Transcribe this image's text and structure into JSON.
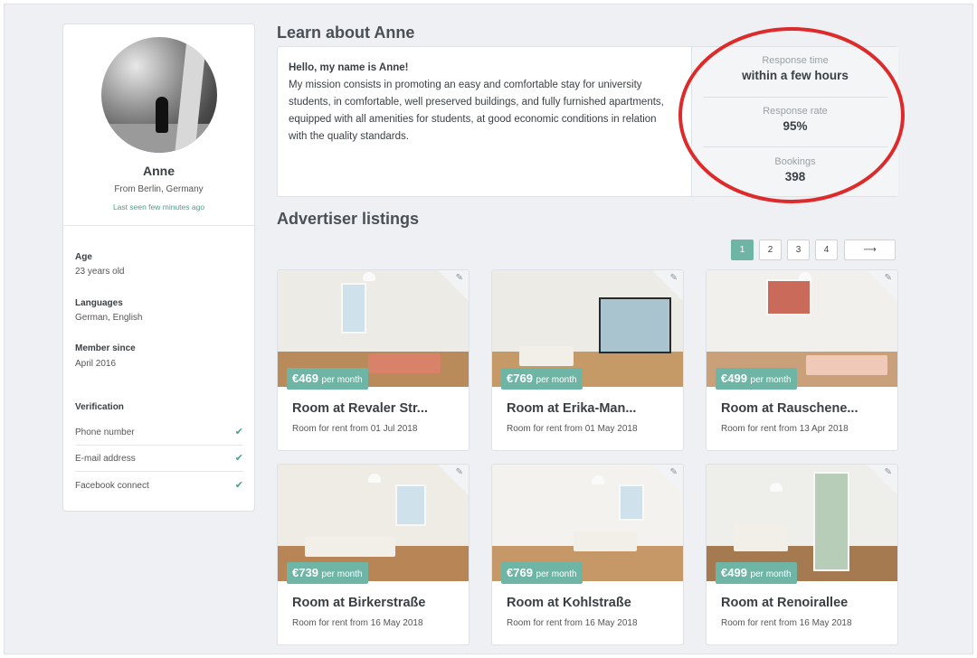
{
  "profile": {
    "name": "Anne",
    "from": "From Berlin, Germany",
    "last_seen": "Last seen few minutes ago",
    "age_label": "Age",
    "age_value": "23 years old",
    "languages_label": "Languages",
    "languages_value": "German, English",
    "member_label": "Member since",
    "member_value": "April 2016",
    "verification_label": "Verification",
    "verifications": [
      {
        "label": "Phone number",
        "icon": "check-icon"
      },
      {
        "label": "E-mail address",
        "icon": "check-icon"
      },
      {
        "label": "Facebook connect",
        "icon": "check-icon"
      }
    ]
  },
  "about": {
    "heading": "Learn about Anne",
    "greeting": "Hello, my name is Anne!",
    "body": "My mission consists in promoting an easy and comfortable stay for university students, in comfortable, well preserved buildings, and fully furnished apartments, equipped with all amenities for students, at good economic conditions in relation with the quality standards."
  },
  "stats": [
    {
      "label": "Response time",
      "value": "within a few hours"
    },
    {
      "label": "Response rate",
      "value": "95%"
    },
    {
      "label": "Bookings",
      "value": "398"
    }
  ],
  "listings": {
    "heading": "Advertiser listings",
    "pagination": {
      "pages": [
        "1",
        "2",
        "3",
        "4"
      ],
      "active": "1",
      "next": "⟶"
    },
    "items": [
      {
        "price": "€469",
        "per": "per month",
        "title": "Room at Revaler Str...",
        "subtitle": "Room for rent from 01 Jul 2018"
      },
      {
        "price": "€769",
        "per": "per month",
        "title": "Room at Erika-Man...",
        "subtitle": "Room for rent from 01 May 2018"
      },
      {
        "price": "€499",
        "per": "per month",
        "title": "Room at Rauschene...",
        "subtitle": "Room for rent from 13 Apr 2018"
      },
      {
        "price": "€739",
        "per": "per month",
        "title": "Room at Birkerstraße",
        "subtitle": "Room for rent from 16 May 2018"
      },
      {
        "price": "€769",
        "per": "per month",
        "title": "Room at Kohlstraße",
        "subtitle": "Room for rent from 16 May 2018"
      },
      {
        "price": "€499",
        "per": "per month",
        "title": "Room at Renoirallee",
        "subtitle": "Room for rent from 16 May 2018"
      }
    ]
  },
  "colors": {
    "accent": "#6fb5a6",
    "annotation": "#dd2a2a",
    "background": "#eef0f3"
  }
}
